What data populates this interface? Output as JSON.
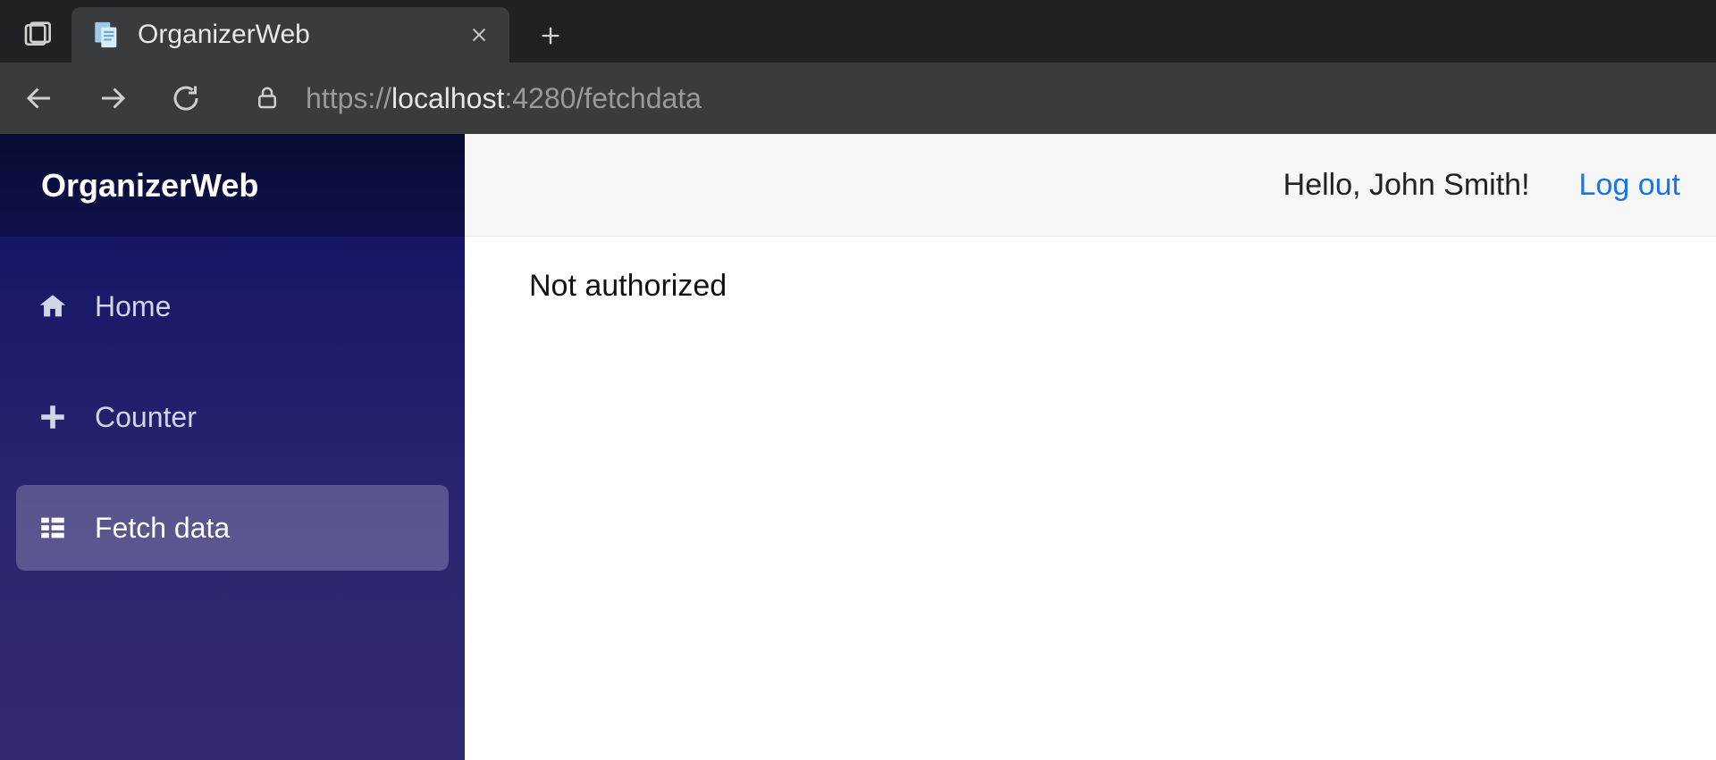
{
  "browser": {
    "tab_title": "OrganizerWeb",
    "url_scheme": "https://",
    "url_host": "localhost",
    "url_port": ":4280",
    "url_path": "/fetchdata"
  },
  "sidebar": {
    "brand": "OrganizerWeb",
    "items": [
      {
        "label": "Home"
      },
      {
        "label": "Counter"
      },
      {
        "label": "Fetch data"
      }
    ]
  },
  "header": {
    "greeting": "Hello, John Smith!",
    "logout_label": "Log out"
  },
  "main": {
    "message": "Not authorized"
  }
}
